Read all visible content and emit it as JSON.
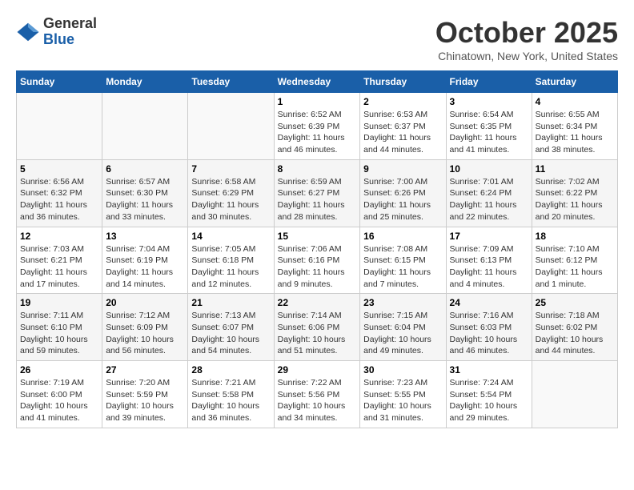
{
  "logo": {
    "general": "General",
    "blue": "Blue"
  },
  "title": "October 2025",
  "location": "Chinatown, New York, United States",
  "days_of_week": [
    "Sunday",
    "Monday",
    "Tuesday",
    "Wednesday",
    "Thursday",
    "Friday",
    "Saturday"
  ],
  "weeks": [
    [
      {
        "day": "",
        "info": ""
      },
      {
        "day": "",
        "info": ""
      },
      {
        "day": "",
        "info": ""
      },
      {
        "day": "1",
        "info": "Sunrise: 6:52 AM\nSunset: 6:39 PM\nDaylight: 11 hours and 46 minutes."
      },
      {
        "day": "2",
        "info": "Sunrise: 6:53 AM\nSunset: 6:37 PM\nDaylight: 11 hours and 44 minutes."
      },
      {
        "day": "3",
        "info": "Sunrise: 6:54 AM\nSunset: 6:35 PM\nDaylight: 11 hours and 41 minutes."
      },
      {
        "day": "4",
        "info": "Sunrise: 6:55 AM\nSunset: 6:34 PM\nDaylight: 11 hours and 38 minutes."
      }
    ],
    [
      {
        "day": "5",
        "info": "Sunrise: 6:56 AM\nSunset: 6:32 PM\nDaylight: 11 hours and 36 minutes."
      },
      {
        "day": "6",
        "info": "Sunrise: 6:57 AM\nSunset: 6:30 PM\nDaylight: 11 hours and 33 minutes."
      },
      {
        "day": "7",
        "info": "Sunrise: 6:58 AM\nSunset: 6:29 PM\nDaylight: 11 hours and 30 minutes."
      },
      {
        "day": "8",
        "info": "Sunrise: 6:59 AM\nSunset: 6:27 PM\nDaylight: 11 hours and 28 minutes."
      },
      {
        "day": "9",
        "info": "Sunrise: 7:00 AM\nSunset: 6:26 PM\nDaylight: 11 hours and 25 minutes."
      },
      {
        "day": "10",
        "info": "Sunrise: 7:01 AM\nSunset: 6:24 PM\nDaylight: 11 hours and 22 minutes."
      },
      {
        "day": "11",
        "info": "Sunrise: 7:02 AM\nSunset: 6:22 PM\nDaylight: 11 hours and 20 minutes."
      }
    ],
    [
      {
        "day": "12",
        "info": "Sunrise: 7:03 AM\nSunset: 6:21 PM\nDaylight: 11 hours and 17 minutes."
      },
      {
        "day": "13",
        "info": "Sunrise: 7:04 AM\nSunset: 6:19 PM\nDaylight: 11 hours and 14 minutes."
      },
      {
        "day": "14",
        "info": "Sunrise: 7:05 AM\nSunset: 6:18 PM\nDaylight: 11 hours and 12 minutes."
      },
      {
        "day": "15",
        "info": "Sunrise: 7:06 AM\nSunset: 6:16 PM\nDaylight: 11 hours and 9 minutes."
      },
      {
        "day": "16",
        "info": "Sunrise: 7:08 AM\nSunset: 6:15 PM\nDaylight: 11 hours and 7 minutes."
      },
      {
        "day": "17",
        "info": "Sunrise: 7:09 AM\nSunset: 6:13 PM\nDaylight: 11 hours and 4 minutes."
      },
      {
        "day": "18",
        "info": "Sunrise: 7:10 AM\nSunset: 6:12 PM\nDaylight: 11 hours and 1 minute."
      }
    ],
    [
      {
        "day": "19",
        "info": "Sunrise: 7:11 AM\nSunset: 6:10 PM\nDaylight: 10 hours and 59 minutes."
      },
      {
        "day": "20",
        "info": "Sunrise: 7:12 AM\nSunset: 6:09 PM\nDaylight: 10 hours and 56 minutes."
      },
      {
        "day": "21",
        "info": "Sunrise: 7:13 AM\nSunset: 6:07 PM\nDaylight: 10 hours and 54 minutes."
      },
      {
        "day": "22",
        "info": "Sunrise: 7:14 AM\nSunset: 6:06 PM\nDaylight: 10 hours and 51 minutes."
      },
      {
        "day": "23",
        "info": "Sunrise: 7:15 AM\nSunset: 6:04 PM\nDaylight: 10 hours and 49 minutes."
      },
      {
        "day": "24",
        "info": "Sunrise: 7:16 AM\nSunset: 6:03 PM\nDaylight: 10 hours and 46 minutes."
      },
      {
        "day": "25",
        "info": "Sunrise: 7:18 AM\nSunset: 6:02 PM\nDaylight: 10 hours and 44 minutes."
      }
    ],
    [
      {
        "day": "26",
        "info": "Sunrise: 7:19 AM\nSunset: 6:00 PM\nDaylight: 10 hours and 41 minutes."
      },
      {
        "day": "27",
        "info": "Sunrise: 7:20 AM\nSunset: 5:59 PM\nDaylight: 10 hours and 39 minutes."
      },
      {
        "day": "28",
        "info": "Sunrise: 7:21 AM\nSunset: 5:58 PM\nDaylight: 10 hours and 36 minutes."
      },
      {
        "day": "29",
        "info": "Sunrise: 7:22 AM\nSunset: 5:56 PM\nDaylight: 10 hours and 34 minutes."
      },
      {
        "day": "30",
        "info": "Sunrise: 7:23 AM\nSunset: 5:55 PM\nDaylight: 10 hours and 31 minutes."
      },
      {
        "day": "31",
        "info": "Sunrise: 7:24 AM\nSunset: 5:54 PM\nDaylight: 10 hours and 29 minutes."
      },
      {
        "day": "",
        "info": ""
      }
    ]
  ]
}
